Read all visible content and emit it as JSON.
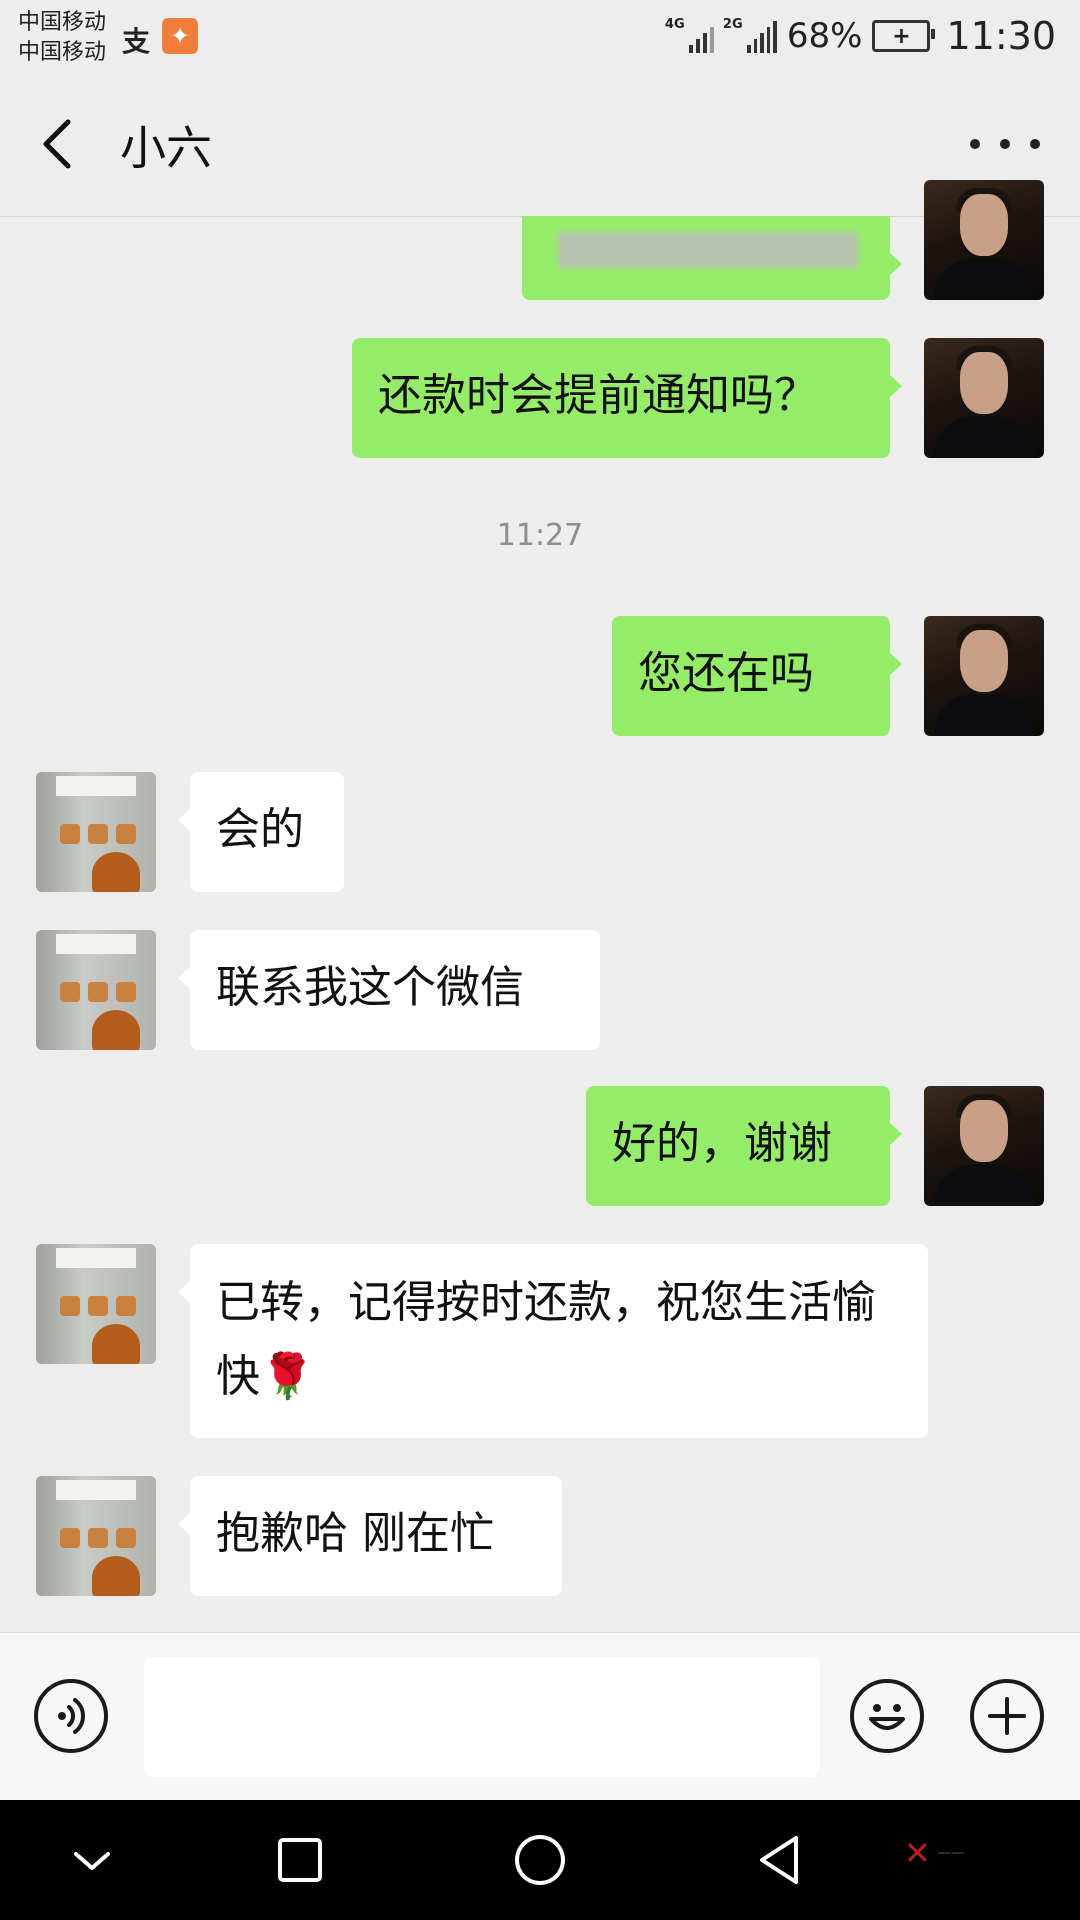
{
  "status_bar": {
    "carrier_1": "中国移动",
    "carrier_2": "中国移动",
    "network_1": "4G",
    "network_2": "2G",
    "battery_percent": "68%",
    "time": "11:30"
  },
  "header": {
    "title": "小六"
  },
  "messages": [
    {
      "side": "me",
      "text": ""
    },
    {
      "side": "me",
      "text": "还款时会提前通知吗？"
    },
    {
      "side": "me",
      "text": "您还在吗"
    },
    {
      "side": "other",
      "text": "会的"
    },
    {
      "side": "other",
      "text": "联系我这个微信"
    },
    {
      "side": "me",
      "text": "好的，谢谢"
    },
    {
      "side": "other",
      "text": "已转，记得按时还款，祝您生活愉快🌹"
    },
    {
      "side": "other",
      "text": "抱歉哈 刚在忙"
    }
  ],
  "timestamp": "11:27",
  "colors": {
    "my_bubble": "#95ec69",
    "other_bubble": "#ffffff",
    "background": "#ededed"
  }
}
